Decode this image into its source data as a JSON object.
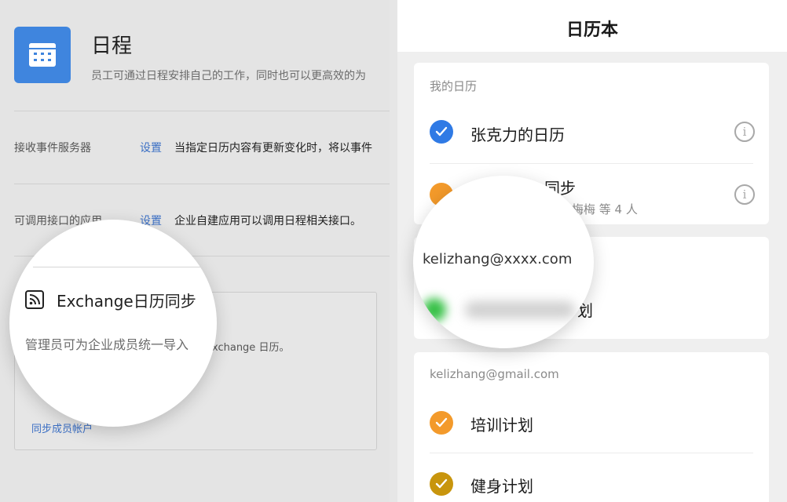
{
  "left": {
    "app_title": "日程",
    "app_desc": "员工可通过日程安排自己的工作，同时也可以更高效的为",
    "rows": [
      {
        "label": "接收事件服务器",
        "link": "设置",
        "text": "当指定日历内容有更新变化时，将以事件"
      },
      {
        "label": "可调用接口的应用",
        "link": "设置",
        "text": "企业自建应用可以调用日程相关接口。"
      }
    ],
    "exchange": {
      "title": "Exchange日历同步",
      "desc": "管理员可为企业成员统一导入",
      "desc_tail": "xchange 日历。",
      "sync_link": "同步成员帐户"
    }
  },
  "right": {
    "header_title": "日历本",
    "my_calendars": {
      "section_title": "我的日历",
      "items": [
        {
          "label": "张克力的日历",
          "color": "#2f7ae5"
        },
        {
          "label": "同步",
          "sub": "韩梅梅 等 4 人",
          "color": "#f39a2b"
        }
      ]
    },
    "account_section": {
      "email": "kelizhang@xxxx.com",
      "items": [
        {
          "label": "划",
          "color": "#38c148"
        }
      ]
    },
    "gmail_section": {
      "section_title": "kelizhang@gmail.com",
      "items": [
        {
          "label": "培训计划",
          "color": "#f39a2b"
        },
        {
          "label": "健身计划",
          "color": "#c8950d"
        }
      ]
    },
    "info_icon_glyph": "i"
  }
}
